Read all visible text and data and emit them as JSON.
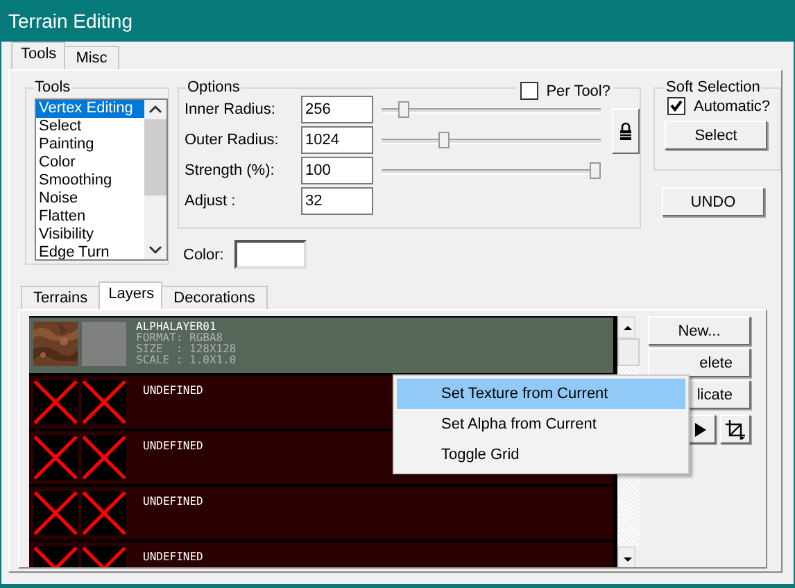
{
  "window": {
    "title": "Terrain Editing"
  },
  "tabs": [
    {
      "label": "Tools",
      "selected": true
    },
    {
      "label": "Misc",
      "selected": false
    }
  ],
  "tools": {
    "title": "Tools",
    "items": [
      {
        "label": "Vertex Editing",
        "selected": true
      },
      {
        "label": "Select",
        "selected": false
      },
      {
        "label": "Painting",
        "selected": false
      },
      {
        "label": "Color",
        "selected": false
      },
      {
        "label": "Smoothing",
        "selected": false
      },
      {
        "label": "Noise",
        "selected": false
      },
      {
        "label": "Flatten",
        "selected": false
      },
      {
        "label": "Visibility",
        "selected": false
      },
      {
        "label": "Edge Turn",
        "selected": false
      }
    ]
  },
  "options": {
    "title": "Options",
    "per_tool": {
      "label": "Per Tool?",
      "checked": false
    },
    "fields": [
      {
        "kind": "slider",
        "label": "Inner Radius:",
        "value": "256",
        "level": 0.08
      },
      {
        "kind": "slider",
        "label": "Outer Radius:",
        "value": "1024",
        "level": 0.27
      },
      {
        "kind": "slider",
        "label": "Strength (%):",
        "value": "100",
        "level": 1
      },
      {
        "kind": "plain",
        "label": "Adjust :",
        "value": "32"
      }
    ]
  },
  "color": {
    "label": "Color:"
  },
  "soft_selection": {
    "title": "Soft Selection",
    "automatic": {
      "label": "Automatic?",
      "checked": true
    },
    "button": "Select"
  },
  "undo_button": "UNDO",
  "sub_tabs": [
    {
      "label": "Terrains",
      "selected": false
    },
    {
      "label": "Layers",
      "selected": true
    },
    {
      "label": "Decorations",
      "selected": false
    }
  ],
  "layers": [
    {
      "kind": "texture",
      "name": "ALPHALAYER01",
      "details": [
        "FORMAT: RGBA8",
        "SIZE  : 128X128",
        "SCALE : 1.0X1.0"
      ],
      "selected": true
    },
    {
      "kind": "undefined",
      "name": "UNDEFINED",
      "selected": false
    },
    {
      "kind": "undefined",
      "name": "UNDEFINED",
      "selected": false
    },
    {
      "kind": "undefined",
      "name": "UNDEFINED",
      "selected": false
    },
    {
      "kind": "undefined",
      "name": "UNDEFINED",
      "selected": false
    }
  ],
  "layer_buttons": [
    "New...",
    "elete",
    "licate"
  ],
  "context_menu": [
    {
      "label": "Set Texture from Current",
      "selected": true
    },
    {
      "label": "Set Alpha from Current",
      "selected": false
    },
    {
      "label": "Toggle Grid",
      "selected": false
    }
  ]
}
